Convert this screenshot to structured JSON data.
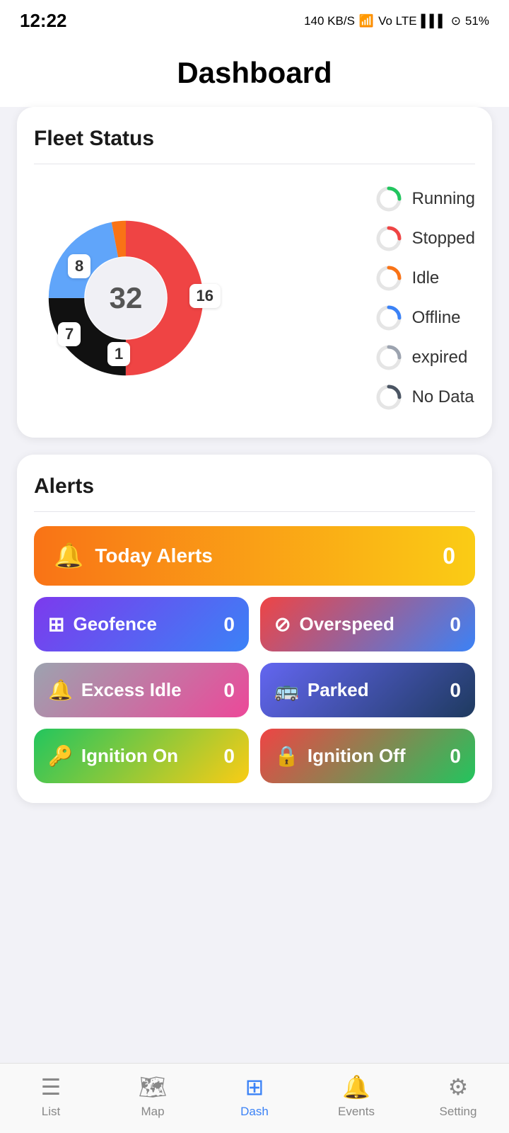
{
  "statusBar": {
    "time": "12:22",
    "network": "140 KB/S",
    "battery": "51%"
  },
  "header": {
    "title": "Dashboard"
  },
  "fleetStatus": {
    "title": "Fleet Status",
    "total": "32",
    "segments": [
      {
        "label": "Running",
        "value": 16,
        "color": "#ef4444",
        "pct": 50
      },
      {
        "label": "Stopped",
        "value": 8,
        "color": "#111111",
        "pct": 25
      },
      {
        "label": "Idle",
        "value": 1,
        "color": "#f97316",
        "pct": 3
      },
      {
        "label": "Offline",
        "value": 7,
        "color": "#60a5fa",
        "pct": 22
      }
    ],
    "segmentLabels": [
      {
        "value": "8",
        "position": "top-left"
      },
      {
        "value": "16",
        "position": "right"
      },
      {
        "value": "7",
        "position": "bottom-left"
      },
      {
        "value": "1",
        "position": "bottom-center"
      }
    ],
    "legend": [
      {
        "label": "Running",
        "color": "#22c55e"
      },
      {
        "label": "Stopped",
        "color": "#ef4444"
      },
      {
        "label": "Idle",
        "color": "#f97316"
      },
      {
        "label": "Offline",
        "color": "#3b82f6"
      },
      {
        "label": "expired",
        "color": "#9ca3af"
      },
      {
        "label": "No Data",
        "color": "#4b5563"
      }
    ]
  },
  "alerts": {
    "title": "Alerts",
    "todayAlerts": {
      "label": "Today Alerts",
      "count": "0",
      "icon": "🔔"
    },
    "buttons": [
      {
        "label": "Geofence",
        "count": "0",
        "icon": "⊞",
        "grad": "grad-geofence"
      },
      {
        "label": "Overspeed",
        "count": "0",
        "icon": "⊘",
        "grad": "grad-overspeed"
      },
      {
        "label": "Excess Idle",
        "count": "0",
        "icon": "🔔",
        "grad": "grad-excess-idle"
      },
      {
        "label": "Parked",
        "count": "0",
        "icon": "🚌",
        "grad": "grad-parked"
      },
      {
        "label": "Ignition On",
        "count": "0",
        "icon": "🔑",
        "grad": "grad-ignition-on"
      },
      {
        "label": "Ignition Off",
        "count": "0",
        "icon": "🔒",
        "grad": "grad-ignition-off"
      }
    ]
  },
  "nav": {
    "items": [
      {
        "label": "List",
        "icon": "≡",
        "active": false
      },
      {
        "label": "Map",
        "icon": "🗺",
        "active": false
      },
      {
        "label": "Dash",
        "icon": "⊞",
        "active": true
      },
      {
        "label": "Events",
        "icon": "🔔",
        "active": false
      },
      {
        "label": "Setting",
        "icon": "⚙",
        "active": false
      }
    ]
  }
}
